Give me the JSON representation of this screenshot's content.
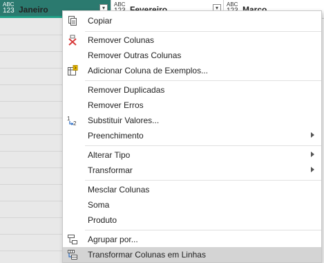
{
  "columns": [
    {
      "type_top": "ABC",
      "type_bottom": "123",
      "name": "Janeiro"
    },
    {
      "type_top": "ABC",
      "type_bottom": "123",
      "name": "Fevereiro"
    },
    {
      "type_top": "ABC",
      "type_bottom": "123",
      "name": "Março"
    }
  ],
  "menu": {
    "copy": "Copiar",
    "remove_columns": "Remover Colunas",
    "remove_other_columns": "Remover Outras Colunas",
    "add_column_examples": "Adicionar Coluna de Exemplos...",
    "remove_duplicates": "Remover Duplicadas",
    "remove_errors": "Remover Erros",
    "replace_values": "Substituir Valores...",
    "fill": "Preenchimento",
    "change_type": "Alterar Tipo",
    "transform": "Transformar",
    "merge_columns": "Mesclar Colunas",
    "sum": "Soma",
    "product": "Produto",
    "group_by": "Agrupar por...",
    "unpivot": "Transformar Colunas em Linhas"
  },
  "icons": {
    "copy": "copy-icon",
    "remove_columns": "remove-columns-icon",
    "add_column_examples": "add-column-examples-icon",
    "replace_values": "replace-values-icon",
    "group_by": "group-by-icon",
    "unpivot": "unpivot-icon"
  },
  "colors": {
    "selected_header": "#2b7a6f",
    "selected_underline": "#1f9e85",
    "highlight": "#d4d4d4",
    "remove_red": "#d83b3b"
  }
}
